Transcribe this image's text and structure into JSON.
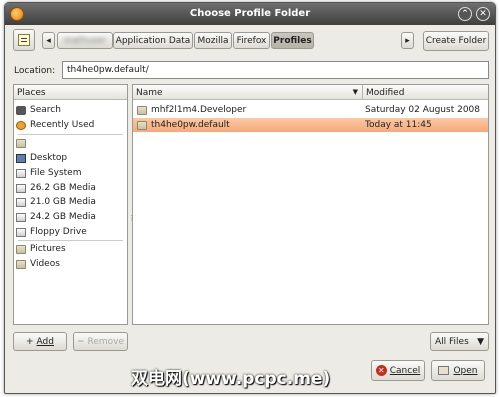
{
  "window": {
    "title": "Choose Profile Folder"
  },
  "path_bar": {
    "crumbs": [
      {
        "label": "mathuser",
        "blurred": true
      },
      {
        "label": "Application Data"
      },
      {
        "label": "Mozilla"
      },
      {
        "label": "Firefox"
      },
      {
        "label": "Profiles",
        "active": true
      }
    ],
    "create_folder": "Create Folder"
  },
  "location": {
    "label": "Location:",
    "value": "th4he0pw.default/"
  },
  "places": {
    "header": "Places",
    "items": [
      {
        "label": "Search",
        "icon": "binoculars-icon"
      },
      {
        "label": "Recently Used",
        "icon": "clock-icon"
      },
      {
        "label": "",
        "icon": "home-folder-icon"
      },
      {
        "label": "Desktop",
        "icon": "desktop-icon"
      },
      {
        "label": "File System",
        "icon": "drive-icon"
      },
      {
        "label": "26.2 GB Media",
        "icon": "drive-icon"
      },
      {
        "label": "21.0 GB Media",
        "icon": "drive-icon"
      },
      {
        "label": "24.2 GB Media",
        "icon": "drive-icon"
      },
      {
        "label": "Floppy Drive",
        "icon": "floppy-icon"
      },
      {
        "label": "Pictures",
        "icon": "folder-icon"
      },
      {
        "label": "Videos",
        "icon": "folder-icon"
      }
    ],
    "add": "Add",
    "remove": "Remove"
  },
  "files": {
    "col_name": "Name",
    "col_modified": "Modified",
    "rows": [
      {
        "name": "mhf2l1m4.Developer",
        "modified": "Saturday 02 August 2008",
        "selected": false
      },
      {
        "name": "th4he0pw.default",
        "modified": "Today at 11:45",
        "selected": true
      }
    ],
    "filter": "All Files"
  },
  "buttons": {
    "cancel": "Cancel",
    "open": "Open"
  },
  "watermark": "双电网(www.pcpc.me)",
  "colors": {
    "selection": "#f5a878",
    "titlebar": "#4a4a4a"
  }
}
